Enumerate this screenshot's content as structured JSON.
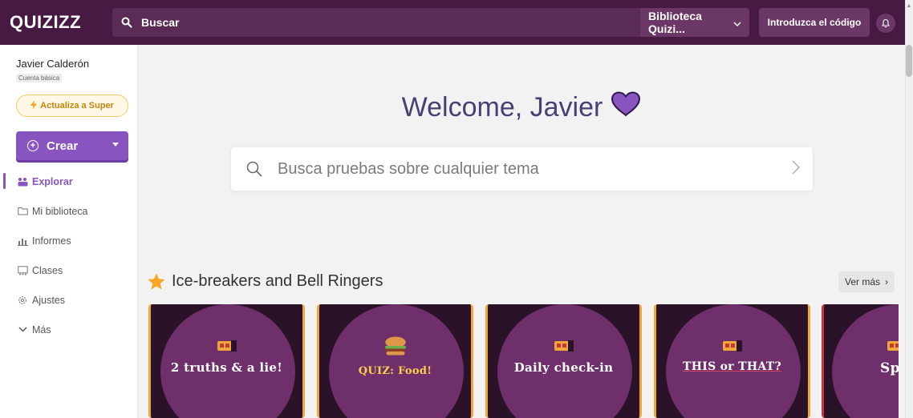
{
  "topbar": {
    "logo": "QUIZIZZ",
    "search_label": "Buscar",
    "library_select": "Biblioteca Quizi...",
    "code_button": "Introduzca el código"
  },
  "sidebar": {
    "user_name": "Javier Calderón",
    "plan": "Cuenta básica",
    "upgrade_label": "Actualiza a Super",
    "create_label": "Crear",
    "items": [
      {
        "label": "Explorar",
        "icon": "explore-icon",
        "active": true
      },
      {
        "label": "Mi biblioteca",
        "icon": "folder-icon",
        "active": false
      },
      {
        "label": "Informes",
        "icon": "reports-icon",
        "active": false
      },
      {
        "label": "Clases",
        "icon": "classes-icon",
        "active": false
      },
      {
        "label": "Ajustes",
        "icon": "settings-icon",
        "active": false
      },
      {
        "label": "Más",
        "icon": "chevron-down-icon",
        "active": false
      }
    ]
  },
  "main": {
    "welcome": "Welcome, Javier",
    "search_placeholder": "Busca pruebas sobre cualquier tema",
    "section_title": "Ice-breakers and Bell Ringers",
    "see_more": "Ver más",
    "cards": [
      {
        "label": "2 truths & a lie!"
      },
      {
        "label": "QUIZ: Food!"
      },
      {
        "label": "Daily check-in"
      },
      {
        "label": "THIS or THAT?"
      },
      {
        "label": "Spotl"
      }
    ]
  },
  "colors": {
    "topbar": "#461a42",
    "accent": "#8854c0",
    "welcome_text": "#4a3f73",
    "card_bg": "#6e2f6a"
  }
}
